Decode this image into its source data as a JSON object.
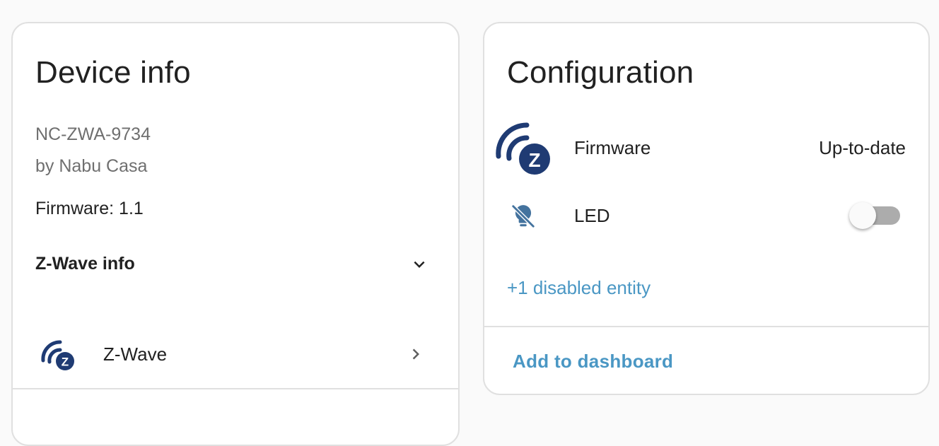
{
  "device_card": {
    "title": "Device info",
    "model": "NC-ZWA-9734",
    "manufacturer": "by Nabu Casa",
    "firmware": "Firmware: 1.1",
    "zwave_info_label": "Z-Wave info",
    "integration_label": "Z-Wave",
    "chevron_down_icon": "chevron-down-icon",
    "chevron_right_icon": "chevron-right-icon",
    "integration_icon": "zwave-icon"
  },
  "config_card": {
    "title": "Configuration",
    "entities": [
      {
        "icon": "zwave-icon",
        "label": "Firmware",
        "state": "Up-to-date"
      },
      {
        "icon": "led-off-icon",
        "label": "LED",
        "state": "off"
      }
    ],
    "disabled_entities_link": "+1 disabled entity",
    "add_to_dashboard": "Add to dashboard"
  },
  "colors": {
    "brand_navy": "#1f3b73",
    "link_blue": "#4a97c4",
    "icon_slate": "#44739e"
  }
}
